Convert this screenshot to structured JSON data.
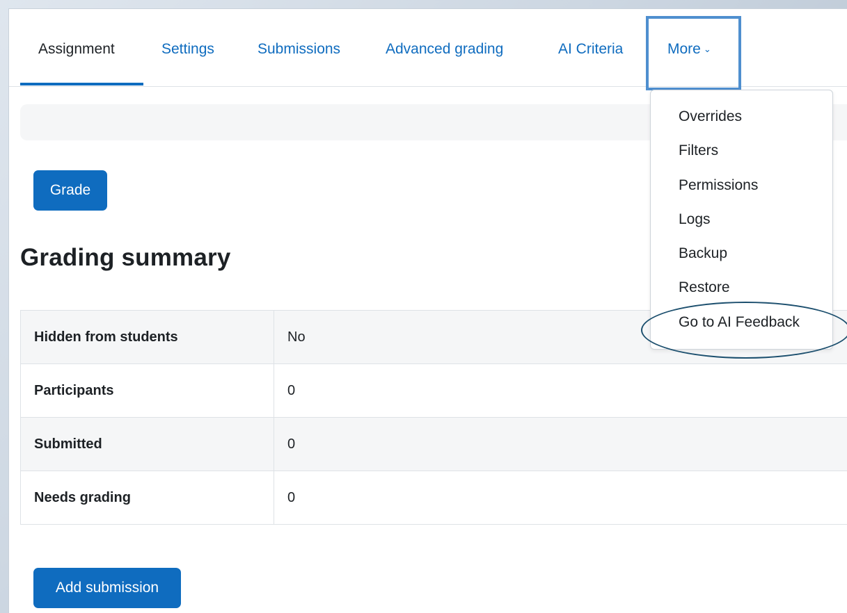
{
  "nav": {
    "tabs": [
      {
        "label": "Assignment"
      },
      {
        "label": "Settings"
      },
      {
        "label": "Submissions"
      },
      {
        "label": "Advanced grading"
      },
      {
        "label": "AI Criteria"
      },
      {
        "label": "More"
      }
    ]
  },
  "more_menu": {
    "items": [
      {
        "label": "Overrides"
      },
      {
        "label": "Filters"
      },
      {
        "label": "Permissions"
      },
      {
        "label": "Logs"
      },
      {
        "label": "Backup"
      },
      {
        "label": "Restore"
      },
      {
        "label": "Go to AI Feedback"
      }
    ]
  },
  "actions": {
    "grade_label": "Grade",
    "add_submission_label": "Add submission"
  },
  "summary": {
    "heading": "Grading summary",
    "rows": [
      {
        "label": "Hidden from students",
        "value": "No"
      },
      {
        "label": "Participants",
        "value": "0"
      },
      {
        "label": "Submitted",
        "value": "0"
      },
      {
        "label": "Needs grading",
        "value": "0"
      }
    ]
  },
  "colors": {
    "accent": "#0f6cbf",
    "highlight_box": "#4f8fcf",
    "highlight_ellipse": "#1c4f6e"
  }
}
